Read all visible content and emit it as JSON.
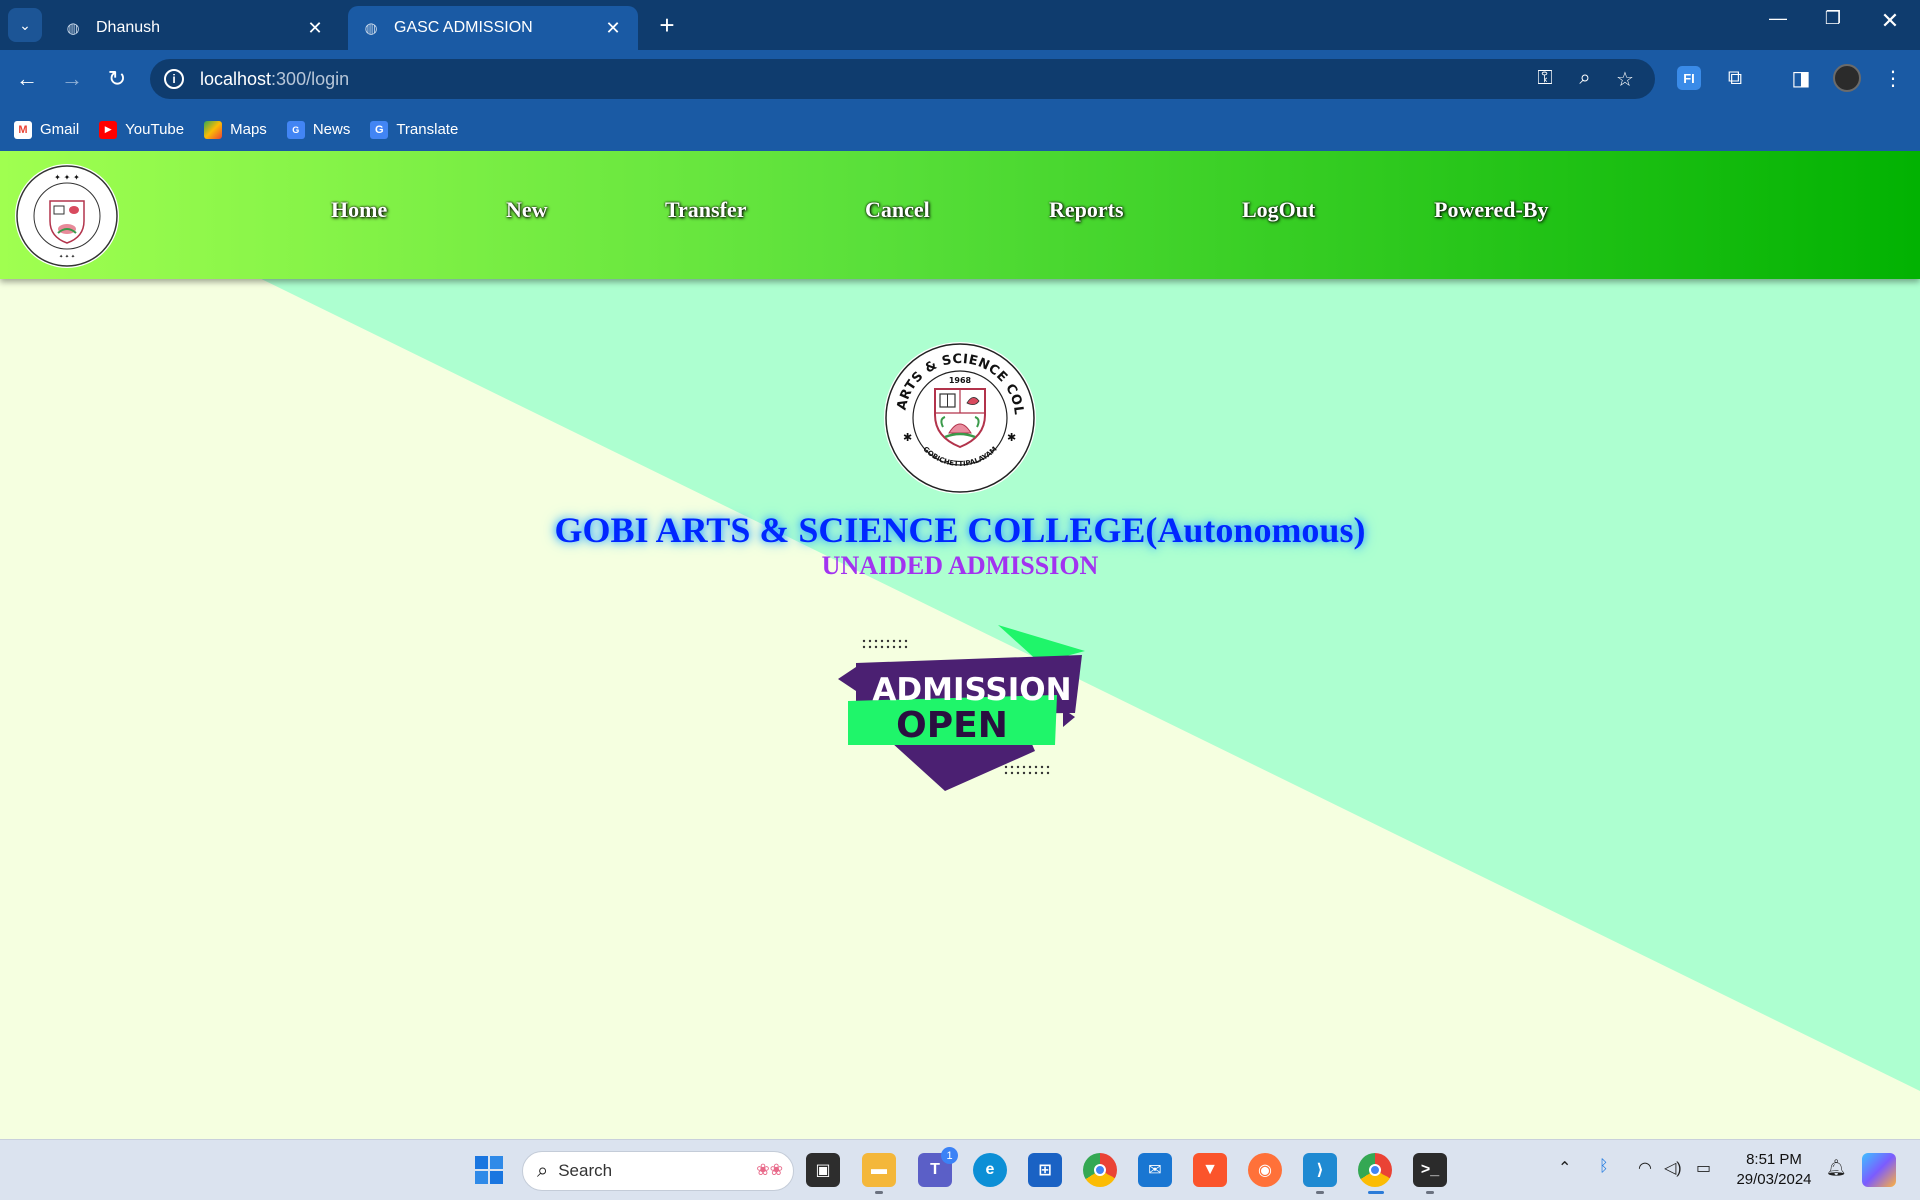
{
  "browser": {
    "tabs": [
      {
        "title": "Dhanush",
        "active": false
      },
      {
        "title": "GASC ADMISSION",
        "active": true
      }
    ],
    "url": {
      "host": "localhost",
      "path": ":300/login"
    },
    "bookmarks": [
      {
        "label": "Gmail",
        "icon": "gmail-icon"
      },
      {
        "label": "YouTube",
        "icon": "youtube-icon"
      },
      {
        "label": "Maps",
        "icon": "maps-icon"
      },
      {
        "label": "News",
        "icon": "news-icon"
      },
      {
        "label": "Translate",
        "icon": "translate-icon"
      }
    ]
  },
  "site": {
    "nav": [
      {
        "label": "Home"
      },
      {
        "label": "New"
      },
      {
        "label": "Transfer"
      },
      {
        "label": "Cancel"
      },
      {
        "label": "Reports"
      },
      {
        "label": "LogOut"
      },
      {
        "label": "Powered-By"
      }
    ],
    "logo": {
      "ring_text": "GOBI ARTS & SCIENCE COLLEGE",
      "year": "1968",
      "bottom_text": "GOBICHETTIPALAYAM"
    },
    "title": "GOBI ARTS & SCIENCE COLLEGE(Autonomous)",
    "subtitle": "UNAIDED ADMISSION",
    "banner": {
      "line1": "ADMISSION",
      "line2": "OPEN"
    },
    "colors": {
      "nav_gradient_start": "#a0ff50",
      "nav_gradient_end": "#02b202",
      "bg_light": "#f5ffe0",
      "bg_mint": "#adffd0",
      "title": "#0026ff",
      "subtitle": "#a233f0",
      "banner_purple": "#4b2072",
      "banner_green": "#1ff56a"
    }
  },
  "taskbar": {
    "search_label": "Search",
    "teams_badge": "1",
    "time": "8:51 PM",
    "date": "29/03/2024"
  }
}
